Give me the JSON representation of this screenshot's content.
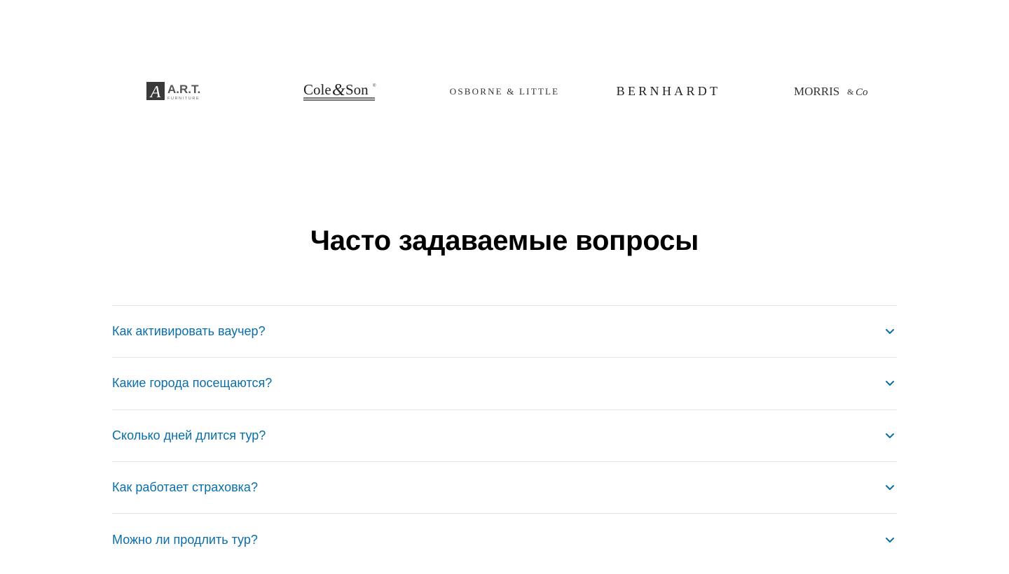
{
  "brands": [
    {
      "id": "art",
      "name": "A.R.T.",
      "sub": "FURNITURE",
      "mark": "A"
    },
    {
      "id": "cole",
      "name_left": "Cole",
      "amp": "&",
      "name_right": "Son",
      "reg": "®"
    },
    {
      "id": "osborne",
      "name": "OSBORNE & LITTLE"
    },
    {
      "id": "bernhardt",
      "name": "BERNHARDT"
    },
    {
      "id": "morris",
      "name": "MORRIS",
      "amp": "&",
      "co": "Co"
    }
  ],
  "faq": {
    "title": "Часто задаваемые вопросы",
    "items": [
      {
        "question": "Как активировать ваучер?"
      },
      {
        "question": "Какие города посещаются?"
      },
      {
        "question": "Сколько дней длится тур?"
      },
      {
        "question": "Как работает страховка?"
      },
      {
        "question": "Можно ли продлить тур?"
      }
    ]
  },
  "colors": {
    "link": "#0a6ea8",
    "divider": "#e3e3e3",
    "title": "#000000"
  },
  "icons": {
    "expand": "chevron-down-icon"
  }
}
